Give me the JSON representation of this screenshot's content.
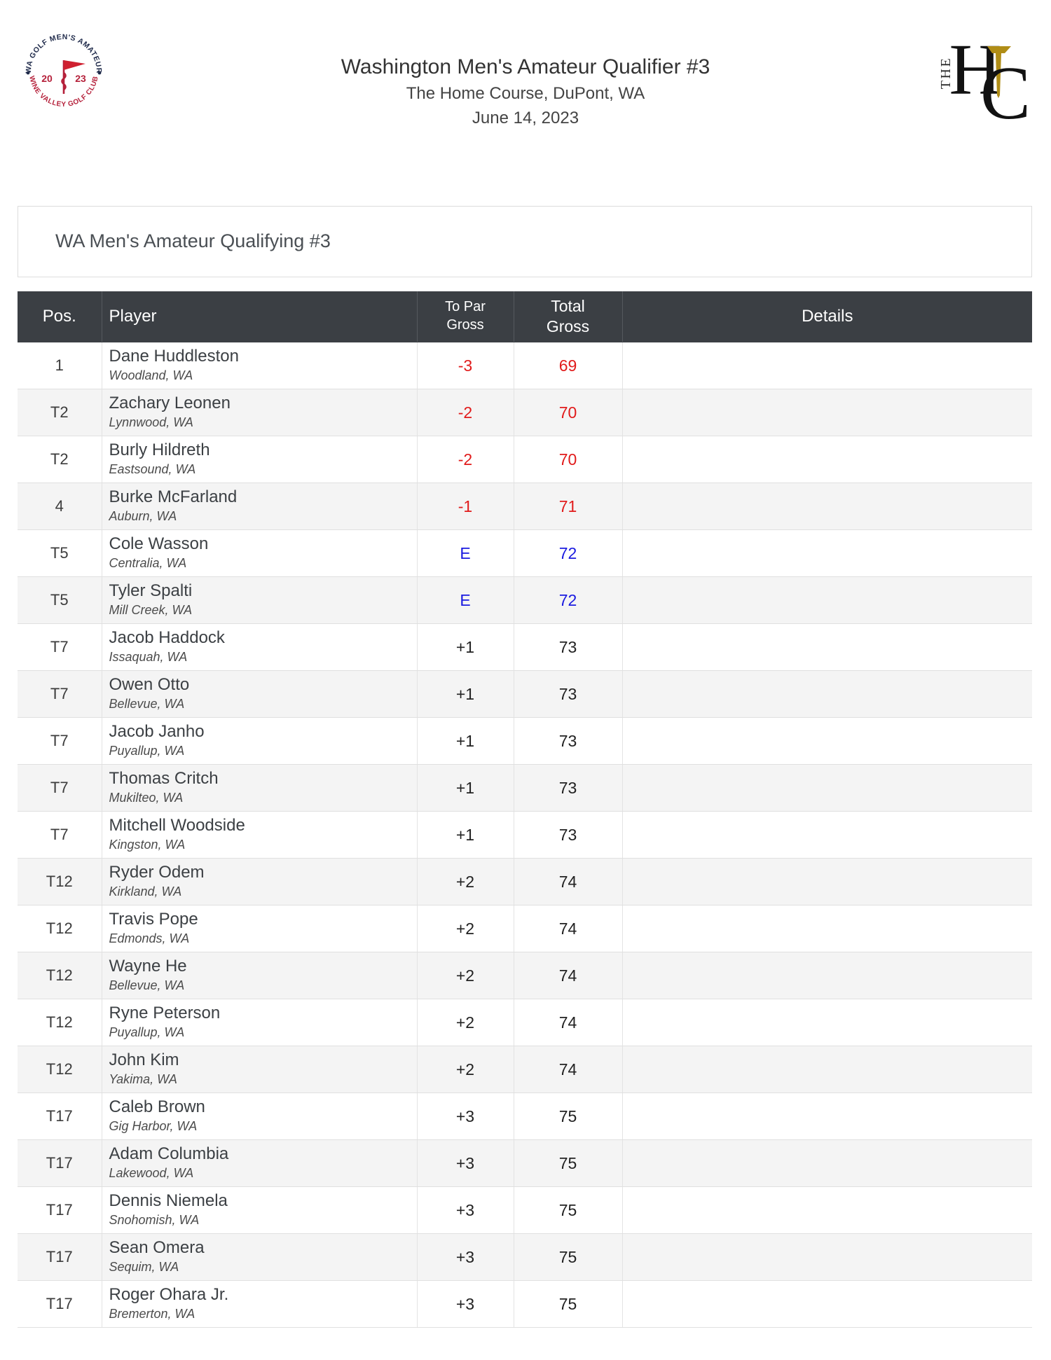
{
  "header": {
    "event_title": "Washington Men's Amateur Qualifier #3",
    "venue": "The Home Course, DuPont, WA",
    "date": "June 14, 2023",
    "left_logo": {
      "name": "wa-golf-mens-amateur-seal",
      "arc_top": "WA GOLF MEN'S AMATEUR",
      "arc_bottom": "WINE VALLEY GOLF CLUB",
      "year_left": "20",
      "year_right": "23"
    },
    "right_logo": {
      "name": "the-home-course-logo",
      "the": "THE",
      "h": "H",
      "c": "C"
    }
  },
  "round_panel": {
    "label": "WA Men's Amateur Qualifying #3"
  },
  "colors": {
    "header_bg": "#3b3f44",
    "under_par": "#e11b1b",
    "even_par": "#1a1ae0",
    "over_par": "#222222",
    "alt_row": "#f4f4f4"
  },
  "table": {
    "columns": [
      {
        "key": "pos",
        "label": "Pos."
      },
      {
        "key": "player",
        "label": "Player"
      },
      {
        "key": "to_par_gross",
        "label_line1": "To Par",
        "label_line2": "Gross"
      },
      {
        "key": "total_gross",
        "label_line1": "Total",
        "label_line2": "Gross"
      },
      {
        "key": "details",
        "label": "Details"
      }
    ],
    "rows": [
      {
        "pos": "1",
        "name": "Dane Huddleston",
        "city": "Woodland, WA",
        "to_par": "-3",
        "total": "69",
        "par_state": "under",
        "details": ""
      },
      {
        "pos": "T2",
        "name": "Zachary Leonen",
        "city": "Lynnwood, WA",
        "to_par": "-2",
        "total": "70",
        "par_state": "under",
        "details": ""
      },
      {
        "pos": "T2",
        "name": "Burly Hildreth",
        "city": "Eastsound, WA",
        "to_par": "-2",
        "total": "70",
        "par_state": "under",
        "details": ""
      },
      {
        "pos": "4",
        "name": "Burke McFarland",
        "city": "Auburn, WA",
        "to_par": "-1",
        "total": "71",
        "par_state": "under",
        "details": ""
      },
      {
        "pos": "T5",
        "name": "Cole Wasson",
        "city": "Centralia, WA",
        "to_par": "E",
        "total": "72",
        "par_state": "even",
        "details": ""
      },
      {
        "pos": "T5",
        "name": "Tyler Spalti",
        "city": "Mill Creek, WA",
        "to_par": "E",
        "total": "72",
        "par_state": "even",
        "details": ""
      },
      {
        "pos": "T7",
        "name": "Jacob Haddock",
        "city": "Issaquah, WA",
        "to_par": "+1",
        "total": "73",
        "par_state": "over",
        "details": ""
      },
      {
        "pos": "T7",
        "name": "Owen Otto",
        "city": "Bellevue, WA",
        "to_par": "+1",
        "total": "73",
        "par_state": "over",
        "details": ""
      },
      {
        "pos": "T7",
        "name": "Jacob Janho",
        "city": "Puyallup, WA",
        "to_par": "+1",
        "total": "73",
        "par_state": "over",
        "details": ""
      },
      {
        "pos": "T7",
        "name": "Thomas Critch",
        "city": "Mukilteo, WA",
        "to_par": "+1",
        "total": "73",
        "par_state": "over",
        "details": ""
      },
      {
        "pos": "T7",
        "name": "Mitchell Woodside",
        "city": "Kingston, WA",
        "to_par": "+1",
        "total": "73",
        "par_state": "over",
        "details": ""
      },
      {
        "pos": "T12",
        "name": "Ryder Odem",
        "city": "Kirkland, WA",
        "to_par": "+2",
        "total": "74",
        "par_state": "over",
        "details": ""
      },
      {
        "pos": "T12",
        "name": "Travis Pope",
        "city": "Edmonds, WA",
        "to_par": "+2",
        "total": "74",
        "par_state": "over",
        "details": ""
      },
      {
        "pos": "T12",
        "name": "Wayne He",
        "city": "Bellevue, WA",
        "to_par": "+2",
        "total": "74",
        "par_state": "over",
        "details": ""
      },
      {
        "pos": "T12",
        "name": "Ryne Peterson",
        "city": "Puyallup, WA",
        "to_par": "+2",
        "total": "74",
        "par_state": "over",
        "details": ""
      },
      {
        "pos": "T12",
        "name": "John Kim",
        "city": "Yakima, WA",
        "to_par": "+2",
        "total": "74",
        "par_state": "over",
        "details": ""
      },
      {
        "pos": "T17",
        "name": "Caleb Brown",
        "city": "Gig Harbor, WA",
        "to_par": "+3",
        "total": "75",
        "par_state": "over",
        "details": ""
      },
      {
        "pos": "T17",
        "name": "Adam Columbia",
        "city": "Lakewood, WA",
        "to_par": "+3",
        "total": "75",
        "par_state": "over",
        "details": ""
      },
      {
        "pos": "T17",
        "name": "Dennis Niemela",
        "city": "Snohomish, WA",
        "to_par": "+3",
        "total": "75",
        "par_state": "over",
        "details": ""
      },
      {
        "pos": "T17",
        "name": "Sean Omera",
        "city": "Sequim, WA",
        "to_par": "+3",
        "total": "75",
        "par_state": "over",
        "details": ""
      },
      {
        "pos": "T17",
        "name": "Roger Ohara Jr.",
        "city": "Bremerton, WA",
        "to_par": "+3",
        "total": "75",
        "par_state": "over",
        "details": ""
      }
    ]
  }
}
